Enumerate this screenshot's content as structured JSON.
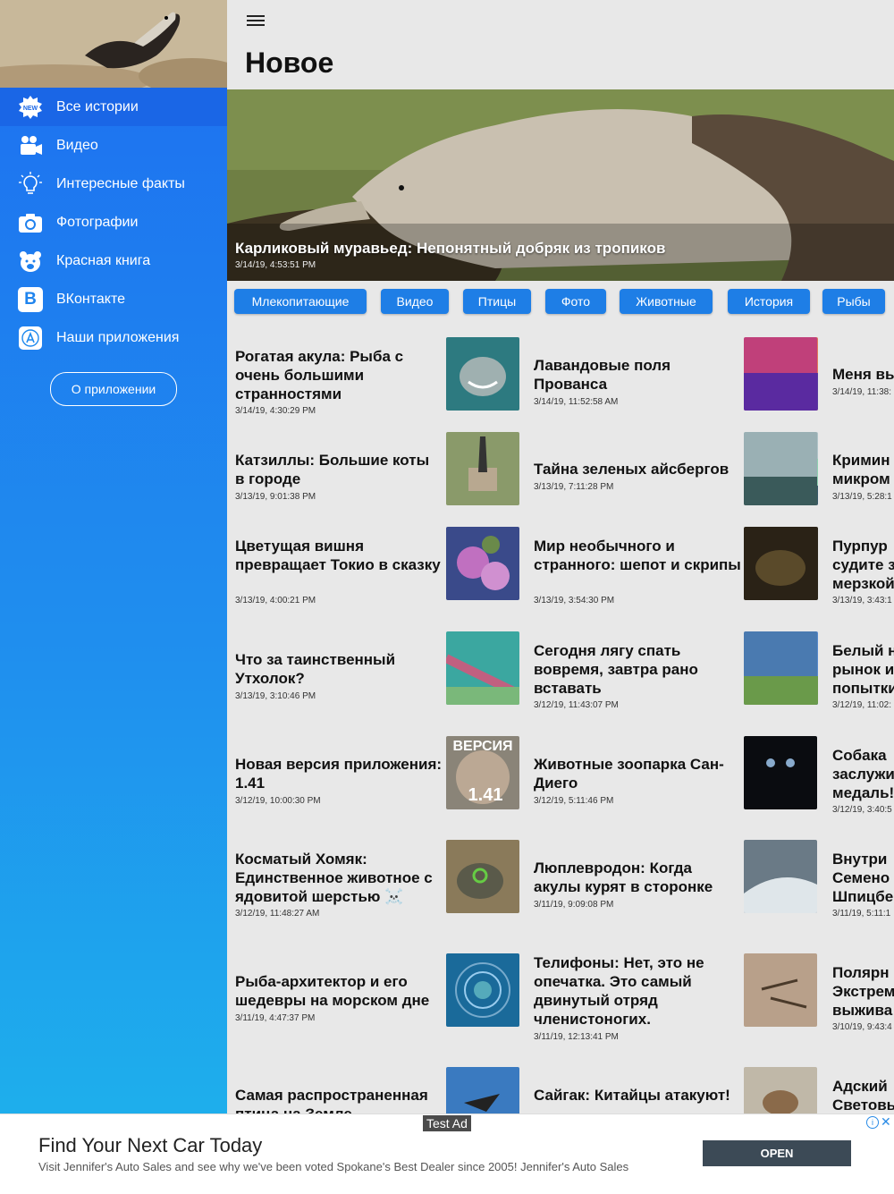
{
  "sidebar": {
    "items": [
      {
        "label": "Все истории",
        "icon": "new-badge-icon"
      },
      {
        "label": "Видео",
        "icon": "video-camera-icon"
      },
      {
        "label": "Интересные факты",
        "icon": "lightbulb-icon"
      },
      {
        "label": "Фотографии",
        "icon": "camera-icon"
      },
      {
        "label": "Красная книга",
        "icon": "bear-icon"
      },
      {
        "label": "ВКонтакте",
        "icon": "vk-icon"
      },
      {
        "label": "Наши приложения",
        "icon": "app-store-icon"
      }
    ],
    "about_label": "О приложении",
    "new_badge": "NEW",
    "vk_letter": "B"
  },
  "header": {
    "title": "Новое"
  },
  "hero": {
    "title": "Карликовый муравьед: Непонятный добряк из тропиков",
    "date": "3/14/19, 4:53:51 PM"
  },
  "categories": [
    "Млекопитающие",
    "Видео",
    "Птицы",
    "Фото",
    "Животные",
    "История",
    "Рыбы"
  ],
  "articles_col1": [
    {
      "title": "Рогатая акула: Рыба с очень большими странностями",
      "date": "3/14/19, 4:30:29 PM"
    },
    {
      "title": "Катзиллы: Большие коты в городе",
      "date": "3/13/19, 9:01:38 PM"
    },
    {
      "title": "Цветущая вишня превращает Токио в сказку",
      "date": "3/13/19, 4:00:21 PM"
    },
    {
      "title": "Что за таинственный Утхолок?",
      "date": "3/13/19, 3:10:46 PM"
    },
    {
      "title": "Новая версия приложения: 1.41",
      "date": "3/12/19, 10:00:30 PM"
    },
    {
      "title": "Косматый Хомяк: Единственное животное с ядовитой шерстью ☠️",
      "date": "3/12/19, 11:48:27 AM"
    },
    {
      "title": "Рыба-архитектор и его шедевры на морском дне",
      "date": "3/11/19, 4:47:37 PM"
    },
    {
      "title": "Самая распространенная птица на Земле",
      "date": ""
    }
  ],
  "articles_col2": [
    {
      "title": "Лавандовые поля Прованса",
      "date": "3/14/19, 11:52:58 AM"
    },
    {
      "title": "Тайна зеленых айсбергов",
      "date": "3/13/19, 7:11:28 PM"
    },
    {
      "title": "Мир необычного и странного: шепот и скрипы",
      "date": "3/13/19, 3:54:30 PM"
    },
    {
      "title": "Сегодня лягу спать вовремя, завтра рано вставать",
      "date": "3/12/19, 11:43:07 PM"
    },
    {
      "title": "Животные зоопарка Сан-Диего",
      "date": "3/12/19, 5:11:46 PM"
    },
    {
      "title": "Люплевродон: Когда акулы курят в сторонке",
      "date": "3/11/19, 9:09:08 PM"
    },
    {
      "title": "Телифоны: Нет, это не опечатка. Это самый двинутый отряд членистоногих.",
      "date": "3/11/19, 12:13:41 PM"
    },
    {
      "title": "Сайгак: Китайцы атакуют!",
      "date": ""
    }
  ],
  "articles_col3": [
    {
      "title": "Меня вы",
      "date": "3/14/19, 11:38:"
    },
    {
      "title": "Кримин микром",
      "date": "3/13/19, 5:28:1"
    },
    {
      "title": "Пурпур судите з мерзкой",
      "date": "3/13/19, 3:43:1"
    },
    {
      "title": "Белый н рынок и попытки",
      "date": "3/12/19, 11:02:"
    },
    {
      "title": "Собака заслужи медаль!",
      "date": "3/12/19, 3:40:5"
    },
    {
      "title": "Внутри Семено Шпицбе",
      "date": "3/11/19, 5:11:1"
    },
    {
      "title": "Полярн Экстрем выжива",
      "date": "3/10/19, 9:43:4"
    },
    {
      "title": "Адский Световь",
      "date": ""
    }
  ],
  "thumb_version_text": "1.41",
  "thumb_version_banner": "ВЕРСИЯ",
  "ad": {
    "tag": "Test Ad",
    "title": "Find Your Next Car Today",
    "description": "Visit Jennifer's Auto Sales and see why we've been voted Spokane's Best Dealer since 2005! Jennifer's Auto Sales",
    "button": "OPEN",
    "info": "i",
    "close": "✕"
  },
  "colors": {
    "accent": "#1e7ee6",
    "sidebar_top": "#1e6ff0",
    "sidebar_bottom": "#1eb4ec"
  }
}
